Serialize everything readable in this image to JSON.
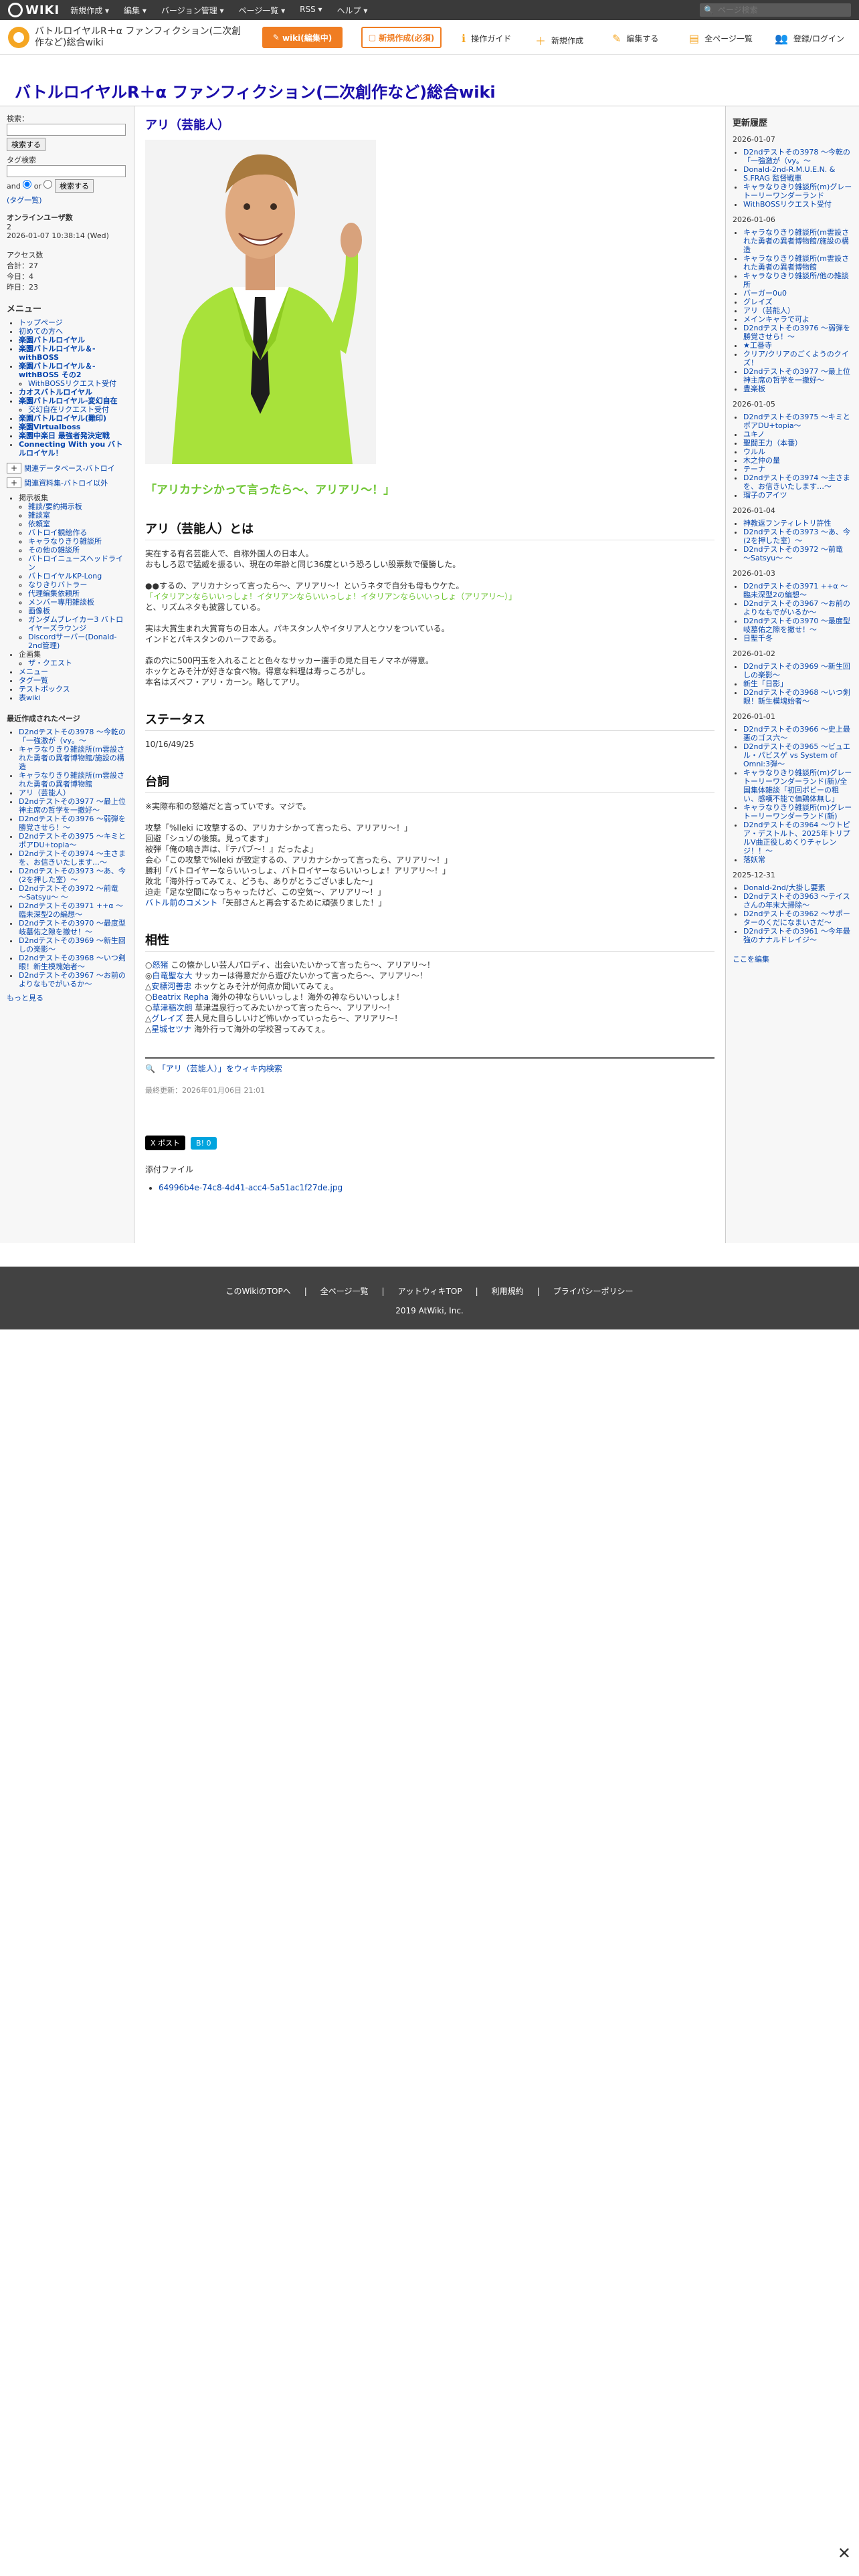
{
  "global": {
    "logo": "WIKI",
    "menu": [
      "新規作成 ▾",
      "編集 ▾",
      "バージョン管理 ▾",
      "ページ一覧 ▾",
      "RSS ▾",
      "ヘルプ ▾"
    ],
    "search_placeholder": "ページ検索"
  },
  "header": {
    "wiki_name": "バトルロイヤルR＋α ファンフィクション(二次創作など)総合wiki",
    "edit_button": "wiki(編集中)",
    "new_button": "新規作成(必須)",
    "nav": [
      {
        "icon": "ℹ",
        "label": "操作ガイド"
      },
      {
        "icon": "＋",
        "label": "新規作成"
      },
      {
        "icon": "✎",
        "label": "編集する"
      },
      {
        "icon": "▤",
        "label": "全ページ一覧"
      },
      {
        "icon": "👥",
        "label": "登録/ログイン"
      }
    ]
  },
  "page_title": "バトルロイヤルR＋α ファンフィクション(二次創作など)総合wiki",
  "left": {
    "search_label": "検索：",
    "search_button": "検索する",
    "tag_label": "タグ検索",
    "tag_button": "検索する",
    "and_label": "and",
    "or_label": "or",
    "tag_link": "(タグ一覧)",
    "online_title": "オンラインユーザ数",
    "online_count": "2",
    "online_time": "2026-01-07 10:38:14 (Wed)",
    "access_title": "アクセス数",
    "access_total": "合計：27",
    "access_today": "今日：4",
    "access_yesterday": "昨日：23",
    "menu_title": "メニュー",
    "menu_items": [
      {
        "t": "トップページ",
        "b": false
      },
      {
        "t": "初めての方へ",
        "b": false
      },
      {
        "t": "楽園バトルロイヤル",
        "b": true
      },
      {
        "t": "楽園バトルロイヤル＆-withBOSS",
        "b": true
      },
      {
        "t": "楽園バトルロイヤル＆-withBOSS その2",
        "b": true
      },
      {
        "t": "WithBOSSリクエスト受付",
        "b": false,
        "sub": true
      },
      {
        "t": "カオスバトルロイヤル",
        "b": true
      },
      {
        "t": "楽園バトルロイヤル-変幻自在",
        "b": true
      },
      {
        "t": "交幻自在リクエスト受付",
        "b": false,
        "sub": true
      },
      {
        "t": "楽園バトルロイヤル(難印)",
        "b": true
      },
      {
        "t": "楽園Virtualboss",
        "b": true
      },
      {
        "t": "楽園中楽日 最強者発決定戦",
        "b": true
      },
      {
        "t": "Connecting With you バトルロイヤル！",
        "b": true
      }
    ],
    "tree1": "関連データベース-バトロイ",
    "tree2": "関連資料集-バトロイ以外",
    "sub_menu_title": "掲示板集",
    "sub_items": [
      "雑談/要約掲示板",
      "雑談室",
      "依頼室",
      "バトロイ観絵作る",
      "キャラなりきり雑談所",
      "その他の雑談所",
      "バトロイニュースヘッドライン",
      "バトロイヤルKP-Long",
      "なりきりバトラー",
      "代理編集依頼所",
      "メンバー専用雑談板",
      "画像板",
      "ガンダムブレイカー3 バトロイヤーズラウンジ",
      "Discordサーバー(Donald-2nd管理)"
    ],
    "extra_title": "企画集",
    "extra_items": [
      "ザ・クエスト"
    ],
    "bottom_items": [
      "メニュー",
      "タグ一覧",
      "テストボックス",
      "表wiki"
    ],
    "recent_title": "最近作成されたページ",
    "recent": [
      "D2ndテストその3978 〜今乾の「一強激が（vy。〜",
      "キャラなりきり雑談所(m雲設された勇者の異者博物館/施設の構造",
      "キャラなりきり雑談所(m雲設された勇者の異者博物館",
      "アリ（芸能人）",
      "D2ndテストその3977 〜最上位神主席の哲学を一撤好〜",
      "D2ndテストその3976 〜弱弾を勝覚させら！〜",
      "D2ndテストその3975 〜キミとポアDU+topia〜",
      "D2ndテストその3974 〜主さまを、お信きいたします…〜",
      "D2ndテストその3973 〜あ、今(2を押した室）〜",
      "D2ndテストその3972 〜前竜 〜Satsyu〜 〜",
      "D2ndテストその3971 ++α 〜臨未深型2の編想〜",
      "D2ndテストその3970 〜最度型岐墓佑之隙を撤せ！〜",
      "D2ndテストその3969 〜新生回しの楽影〜",
      "D2ndテストその3968 〜いつ剣眼！新生模塊始者〜",
      "D2ndテストその3967 〜お前のよりなもでがいるか〜"
    ],
    "more": "もっと見る"
  },
  "main": {
    "heading": "アリ（芸能人）",
    "photo_alt": "smiling man in lime green suit",
    "catch": "「アリカナシかって言ったら〜、アリアリ〜！」",
    "h_about": "アリ（芸能人）とは",
    "about": [
      "実在する有名芸能人で、自称外国人の日本人。",
      "おもしろ忍で猛威を振るい、現在の年齢と同じ36度という恐ろしい股票数で優勝した。"
    ],
    "about2a": "●●するの、アリカナシって言ったら〜、アリアリ〜！というネタで自分も母もウケた。",
    "about2b": "「イタリアンならいいっしょ！イタリアンならいいっしょ！イタリアンならいいっしょ（アリアリ〜）」",
    "about2c": "と、リズムネタも披露している。",
    "about3": [
      "実は大賞生まれ大賞育ちの日本人。パキスタン人やイタリア人とウソをついている。",
      "インドとパキスタンのハーフである。"
    ],
    "about4": [
      "森の穴に500円玉を入れることと色々なサッカー選手の見た目モノマネが得意。",
      "ホッケとみそ汁が好きな食べ物。得意な料理は寿っころがし。",
      "本名はズペフ・アリ・カーン。略してアリ。"
    ],
    "h_status": "ステータス",
    "status": "10/16/49/25",
    "h_lines": "台詞",
    "lines_note": "※実際布和の怒嬉だと言っていです。マジで。",
    "lines": [
      "攻撃「%lleki に攻撃するの、アリカナシかって言ったら、アリアリ〜！」",
      "回避「シュゾの後策。見ってます」",
      "被弾「俺の鳴き声は、『テパブ〜！』だったよ」",
      "会心「この攻撃で%lleki が致定するの、アリカナシかって言ったら、アリアリ〜！」",
      "勝利「バトロイヤーならいいっしょ、バトロイヤーならいいっしょ！アリアリ〜！」",
      "敗北「海外行ってみてぇ、どうも、ありがとうございました〜」",
      "迫走「足な空間になっちゃったけど、この空気〜、アリアリ〜！」"
    ],
    "lines_link": "バトル前のコメント",
    "lines_last": "「矢部さんと再会するために頑張りました！」",
    "h_compat": "相性",
    "compat": [
      {
        "mark": "○",
        "name": "怒猪",
        "text": "この懐かしい芸人パロディ、出会いたいかって言ったら〜、アリアリ〜！"
      },
      {
        "mark": "◎",
        "name": "白竜聖な大",
        "text": "サッカーは得意だから遊びたいかって言ったら〜、アリアリ〜！"
      },
      {
        "mark": "△",
        "name": "安標河善忠",
        "text": "ホッケとみそ汁が何点か聞いてみてぇ。"
      },
      {
        "mark": "○",
        "name": "Beatrix Repha",
        "text": "海外の神ならいいっしょ！海外の神ならいいっしょ！"
      },
      {
        "mark": "○",
        "name": "草津稲次朗",
        "text": "草津温泉行ってみたいかって言ったら〜、アリアリ〜！"
      },
      {
        "mark": "△",
        "name": "グレイズ",
        "text": "芸人見た目らしいけど怖いかっていったら〜、アリアリ〜！"
      },
      {
        "mark": "△",
        "name": "星城セツナ",
        "text": "海外行って海外の学校習ってみてぇ。"
      }
    ],
    "wiki_search": "「アリ（芸能人）」をウィキ内検索",
    "updated": "最終更新：2026年01月06日 21:01",
    "xpost": "X ポスト",
    "bookmark": "B! 0",
    "attach_title": "添付ファイル",
    "attach_file": "64996b4e-74c8-4d41-acc4-5a51ac1f27de.jpg"
  },
  "right": {
    "title": "更新履歴",
    "groups": [
      {
        "date": "2026-01-07",
        "items": [
          "D2ndテストその3978 〜今乾の「一強激が（vy。〜",
          "Donald-2nd-R.M.U.E.N. & S.FRAG 監督戦車",
          "キャラなりきり雑談所(m)グレートーリーワンダーランド",
          "WithBOSSリクエスト受付"
        ]
      },
      {
        "date": "2026-01-06",
        "items": [
          "キャラなりきり雑談所(m雲設された勇者の異者博物館/施設の構造",
          "キャラなりきり雑談所(m雲設された勇者の異者博物館",
          "キャラなりきり雑談所/他の雑談所",
          "バーガー0u0",
          "グレイズ",
          "アリ（芸能人）",
          "メインキャラで可よ",
          "D2ndテストその3976 〜弱弾を勝覚させら！〜",
          "★工番寺",
          "クリア/クリアのごくようのクイズ！",
          "D2ndテストその3977 〜最上位神主席の哲学を一撤好〜",
          "豊楽板"
        ]
      },
      {
        "date": "2026-01-05",
        "items": [
          "D2ndテストその3975 〜キミとポアDU+topia〜",
          "ユキノ",
          "聖闘王力（本番）",
          "ウルル",
          "木之仲の量",
          "テーナ",
          "D2ndテストその3974 〜主さまを、お信きいたします…〜",
          "瑠子のアイツ"
        ]
      },
      {
        "date": "2026-01-04",
        "items": [
          "神教返フンティレトリ許性",
          "D2ndテストその3973 〜あ、今(2を押した室）〜",
          "D2ndテストその3972 〜前竜 〜Satsyu〜 〜"
        ]
      },
      {
        "date": "2026-01-03",
        "items": [
          "D2ndテストその3971 ++α 〜臨未深型2の編想〜",
          "D2ndテストその3967 〜お前のよりなもでがいるか〜",
          "D2ndテストその3970 〜最度型岐墓佑之隙を撤せ！〜",
          "日聖千冬"
        ]
      },
      {
        "date": "2026-01-02",
        "items": [
          "D2ndテストその3969 〜新生回しの楽影〜",
          "新生「日影」",
          "D2ndテストその3968 〜いつ剣眼！新生模塊始者〜"
        ]
      },
      {
        "date": "2026-01-01",
        "items": [
          "D2ndテストその3966 〜史上最悪のゴス六〜",
          "D2ndテストその3965 〜ビュエル・パビスゲ vs System of Omni:3弾〜",
          "キャラなりきり雑談所(m)グレートーリーワンダーランド(新)/全国集体雑談「初回ポビーの粗い、感嘆不能で価鶏体無し」",
          "キャラなりきり雑談所(m)グレートーリーワンダーランド(新)",
          "D2ndテストその3964 〜ウトピア・デストルト、2025年トリプルV曲正役しめくりチャレンジ！！〜",
          "落妖常"
        ]
      },
      {
        "date": "2025-12-31",
        "items": [
          "Donald-2nd/大掛し要素",
          "D2ndテストその3963 〜テイスさんの年末大掃除〜",
          "D2ndテストその3962 〜サポーターのくだになまいさだ〜",
          "D2ndテストその3961 〜今年最強のナナルドレイジ〜"
        ]
      }
    ],
    "here": "ここを編集"
  },
  "footer": {
    "links": [
      "このWikiのTOPへ",
      "全ページ一覧",
      "アットウィキTOP",
      "利用規約",
      "プライバシーポリシー"
    ],
    "copy": "2019 AtWiki, Inc."
  },
  "colors": {
    "accent": "#f07d22",
    "green": "#6ec532",
    "link": "#0645ad",
    "footer": "#424242"
  }
}
